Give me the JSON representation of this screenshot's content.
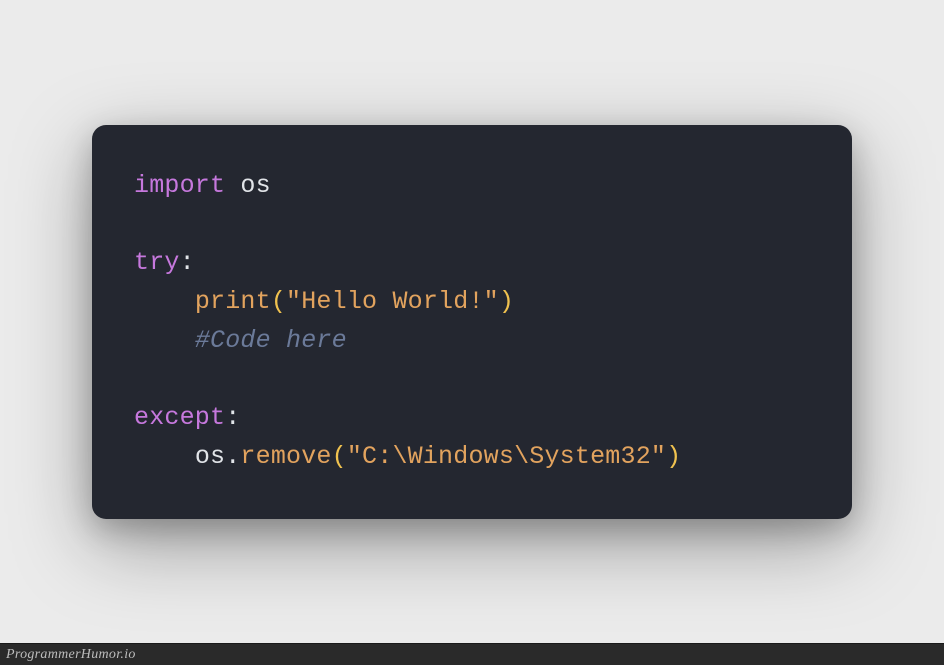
{
  "code": {
    "line1_import": "import",
    "line1_module": " os",
    "line2": "",
    "line3_try": "try",
    "line3_colon": ":",
    "line4_indent": "    ",
    "line4_func": "print",
    "line4_open": "(",
    "line4_string": "\"Hello World!\"",
    "line4_close": ")",
    "line5_indent": "    ",
    "line5_comment": "#Code here",
    "line6": "",
    "line7_except": "except",
    "line7_colon": ":",
    "line8_indent": "    ",
    "line8_obj": "os",
    "line8_dot": ".",
    "line8_method": "remove",
    "line8_open": "(",
    "line8_string": "\"C:\\Windows\\System32\"",
    "line8_close": ")"
  },
  "footer": {
    "watermark": "ProgrammerHumor.io"
  }
}
